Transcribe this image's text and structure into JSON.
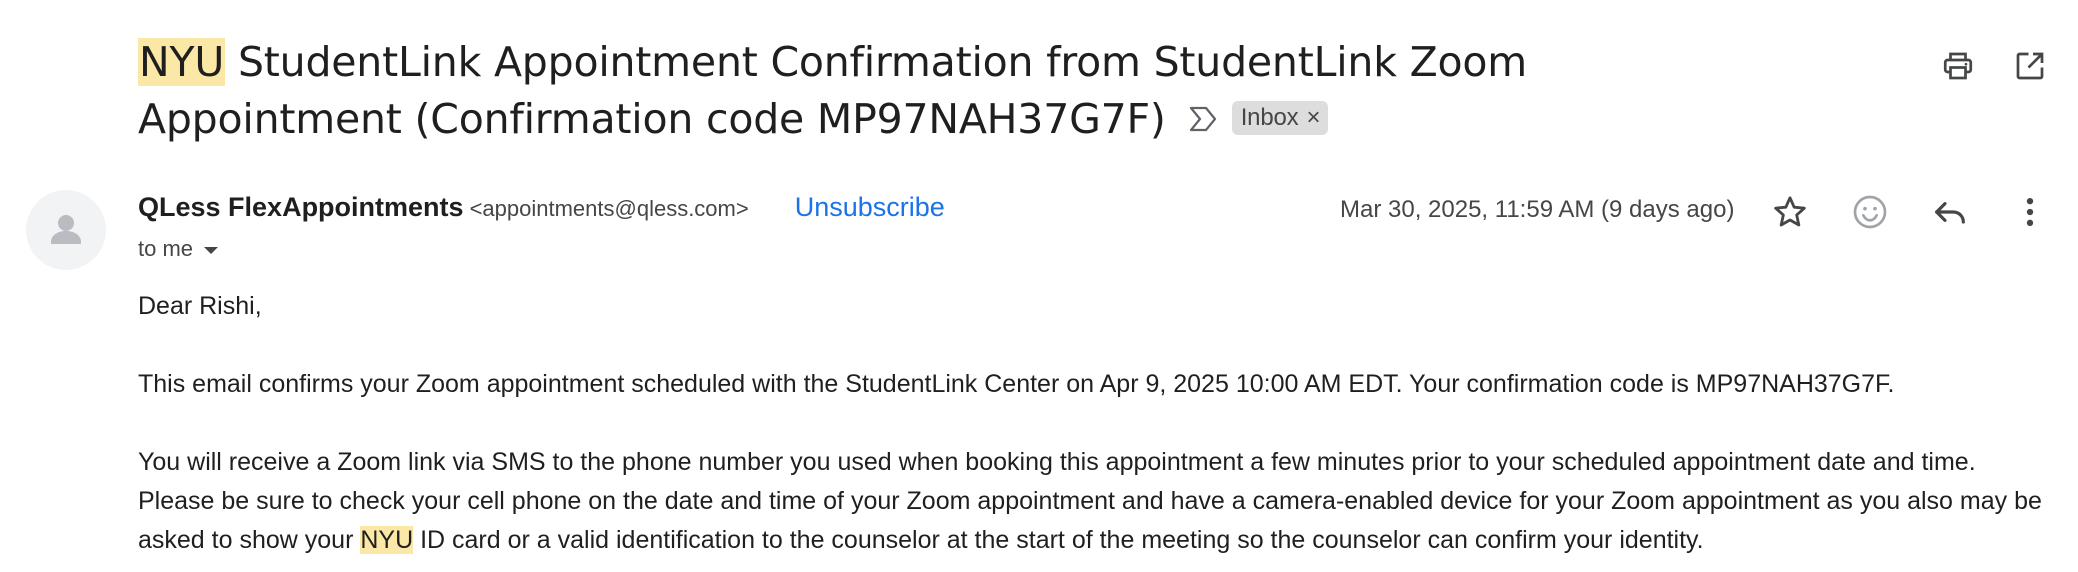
{
  "subject": {
    "highlight": "NYU",
    "rest": " StudentLink Appointment Confirmation from StudentLink Zoom Appointment (Confirmation code MP97NAH37G7F)",
    "label": "Inbox",
    "label_close": "×"
  },
  "toolbar": {
    "print_icon": "print-icon",
    "open_new_window_icon": "open-in-new-window-icon"
  },
  "message": {
    "sender_name": "QLess FlexAppointments",
    "sender_email": "<appointments@qless.com>",
    "unsubscribe": "Unsubscribe",
    "recipient": "to me",
    "date": "Mar 30, 2025, 11:59 AM (9 days ago)",
    "actions": [
      "star-icon",
      "emoji-reaction-icon",
      "reply-icon",
      "more-options-icon"
    ]
  },
  "body": {
    "greeting": "Dear Rishi,",
    "p1": "This email confirms your Zoom appointment scheduled with the StudentLink Center on Apr 9, 2025 10:00 AM EDT. Your confirmation code is MP97NAH37G7F.",
    "p2_before": "You will receive a Zoom link via SMS to the phone number you used when booking this appointment a few minutes prior to your scheduled appointment date and time. Please be sure to check your cell phone on the date and time of your Zoom appointment and have a camera-enabled device for your Zoom appointment as you also may be asked to show your ",
    "p2_highlight": "NYU",
    "p2_after": " ID card or a valid identification to the counselor at the start of the meeting so the counselor can confirm your identity."
  },
  "colors": {
    "highlight": "#fce8a6",
    "link": "#1a73e8",
    "label_bg": "#dddddd",
    "text": "#1f1f1f",
    "muted": "#444746"
  }
}
